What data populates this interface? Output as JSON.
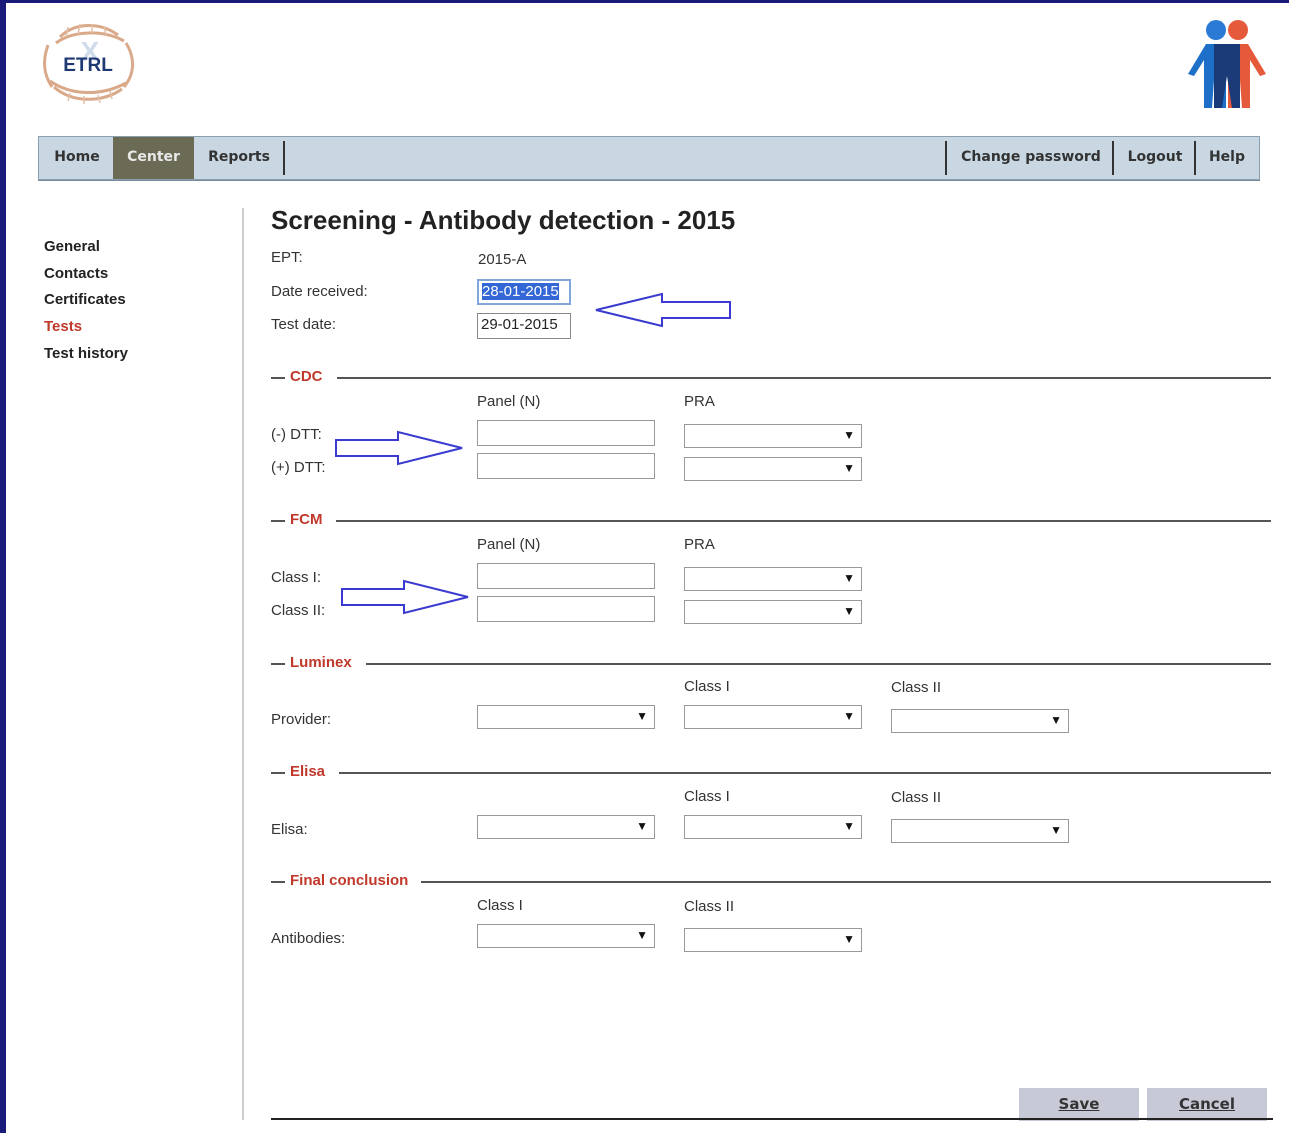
{
  "brand": {
    "logo_text": "ETRL"
  },
  "nav": {
    "home": "Home",
    "center": "Center",
    "reports": "Reports",
    "change_password": "Change password",
    "logout": "Logout",
    "help": "Help"
  },
  "sidebar": {
    "items": [
      {
        "label": "General",
        "active": false
      },
      {
        "label": "Contacts",
        "active": false
      },
      {
        "label": "Certificates",
        "active": false
      },
      {
        "label": "Tests",
        "active": true
      },
      {
        "label": "Test history",
        "active": false
      }
    ]
  },
  "form": {
    "title": "Screening - Antibody detection - 2015",
    "ept_label": "EPT:",
    "ept_value": "2015-A",
    "date_received_label": "Date received:",
    "date_received_value": "28-01-2015",
    "test_date_label": "Test date:",
    "test_date_value": "29-01-2015"
  },
  "cdc": {
    "title": "CDC",
    "col_panel": "Panel (N)",
    "col_pra": "PRA",
    "row1_label": "(-) DTT:",
    "row2_label": "(+) DTT:"
  },
  "fcm": {
    "title": "FCM",
    "col_panel": "Panel (N)",
    "col_pra": "PRA",
    "row1_label": "Class I:",
    "row2_label": "Class II:"
  },
  "luminex": {
    "title": "Luminex",
    "col_class1": "Class I",
    "col_class2": "Class II",
    "row_label": "Provider:"
  },
  "elisa": {
    "title": "Elisa",
    "col_class1": "Class I",
    "col_class2": "Class II",
    "row_label": "Elisa:"
  },
  "final": {
    "title": "Final conclusion",
    "col_class1": "Class I",
    "col_class2": "Class II",
    "row_label": "Antibodies:"
  },
  "actions": {
    "save": "Save",
    "cancel": "Cancel"
  },
  "colors": {
    "accent_red": "#c0392b",
    "nav_bg": "#c8d7e2",
    "nav_active": "#6b6a55",
    "annotation_arrow": "#3a3ad0"
  }
}
